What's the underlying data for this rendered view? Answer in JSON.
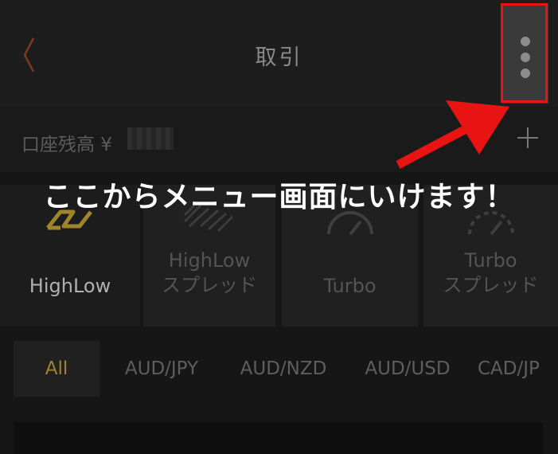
{
  "header": {
    "back_icon": "chevron-left-icon",
    "title": "取引",
    "menu_icon": "more-vertical-icon"
  },
  "balance": {
    "label": "口座残高 ¥",
    "add_icon": "plus-icon"
  },
  "annotation": {
    "text": "ここからメニュー画面にいけます！",
    "color": "#e81414"
  },
  "products": [
    {
      "line1": "HighLow",
      "line2": "",
      "icon": "highlow-icon"
    },
    {
      "line1": "HighLow",
      "line2": "スプレッド",
      "icon": "highlow-spread-icon"
    },
    {
      "line1": "Turbo",
      "line2": "",
      "icon": "turbo-icon"
    },
    {
      "line1": "Turbo",
      "line2": "スプレッド",
      "icon": "turbo-spread-icon"
    }
  ],
  "tabs": [
    "All",
    "AUD/JPY",
    "AUD/NZD",
    "AUD/USD",
    "CAD/JP"
  ],
  "colors": {
    "accent": "#a0842c",
    "background": "#161616"
  }
}
